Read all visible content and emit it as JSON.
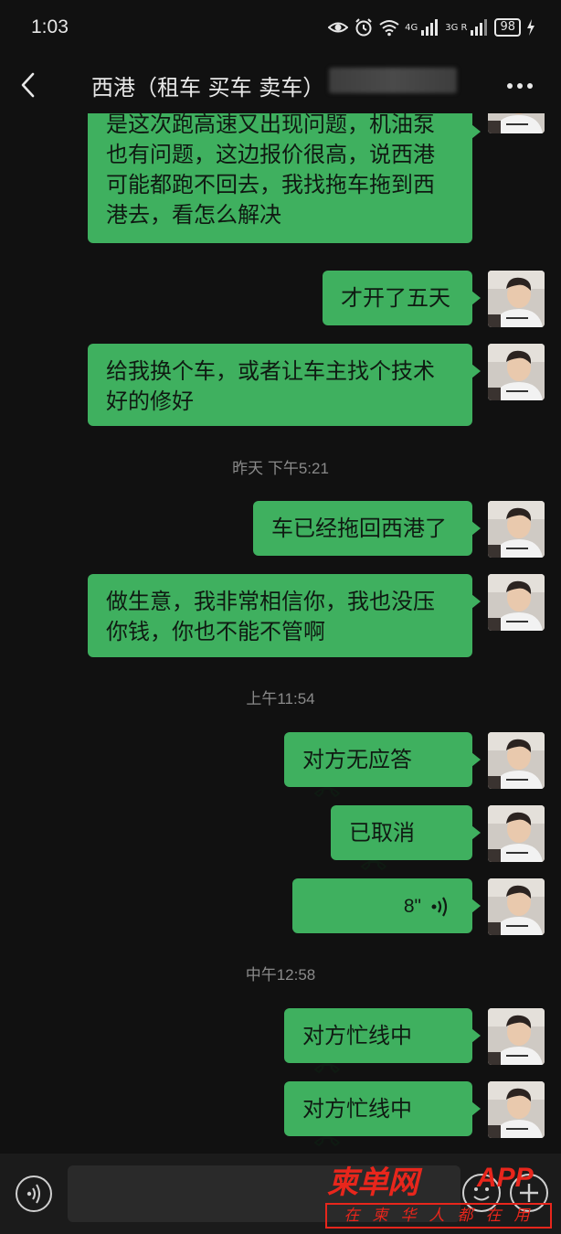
{
  "status_bar": {
    "time": "1:03",
    "net1": "4G",
    "net2": "3G R",
    "battery": "98"
  },
  "header": {
    "title": "西港（租车 买车 卖车）"
  },
  "messages": [
    {
      "type": "text",
      "text": "是这次跑高速又出现问题，机油泵也有问题，这边报价很高，说西港可能都跑不回去，我找拖车拖到西港去，看怎么解决"
    },
    {
      "type": "text",
      "text": "才开了五天"
    },
    {
      "type": "text",
      "text": "给我换个车，或者让车主找个技术好的修好"
    },
    {
      "type": "time",
      "text": "昨天 下午5:21"
    },
    {
      "type": "text",
      "text": "车已经拖回西港了"
    },
    {
      "type": "text",
      "text": "做生意，我非常相信你，我也没压你钱，你也不能不管啊"
    },
    {
      "type": "time",
      "text": "上午11:54"
    },
    {
      "type": "call",
      "text": "对方无应答"
    },
    {
      "type": "call",
      "text": "已取消"
    },
    {
      "type": "voice",
      "text": "8\""
    },
    {
      "type": "time",
      "text": "中午12:58"
    },
    {
      "type": "call",
      "text": "对方忙线中"
    },
    {
      "type": "call",
      "text": "对方忙线中"
    }
  ],
  "watermark": {
    "main": "柬单网",
    "app": "APP",
    "sub": "在柬华人都在用"
  },
  "colors": {
    "background": "#111111",
    "bubble": "#3fb05f",
    "watermark": "#e8261c"
  },
  "icons": [
    "back-arrow-icon",
    "more-icon",
    "eye-icon",
    "alarm-icon",
    "wifi-icon",
    "signal-icon",
    "battery-icon",
    "hangup-icon",
    "voice-wave-icon",
    "voice-input-icon",
    "emoji-icon",
    "plus-icon"
  ]
}
